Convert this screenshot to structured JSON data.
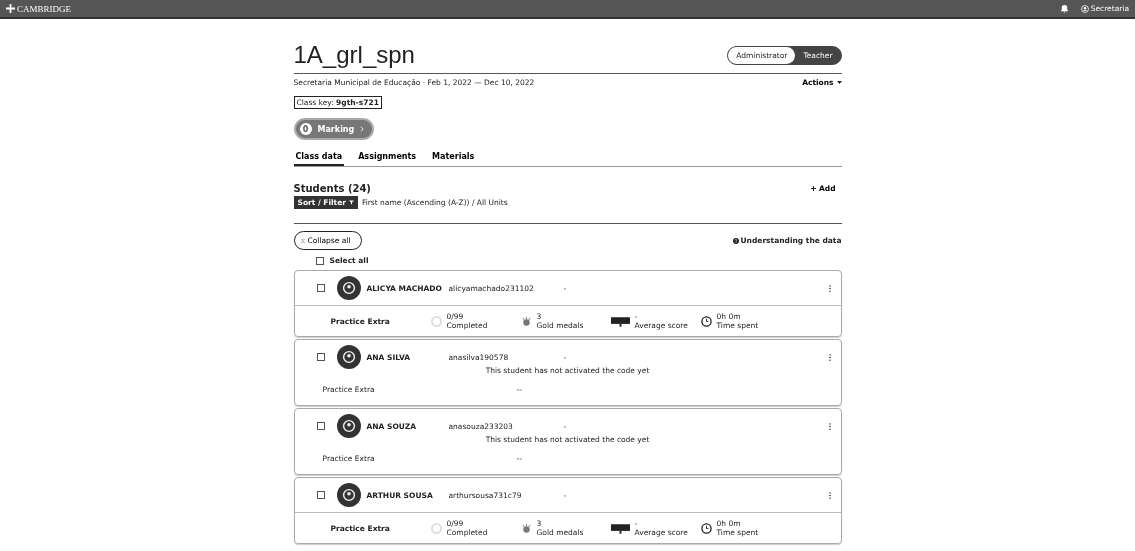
{
  "top_bar": {
    "logo": "CAMBRIDGE",
    "user": "Secretaria"
  },
  "class": {
    "title": "1A_grl_spn",
    "meta": "Secretaria Municipal de Educação · Feb 1, 2022 — Dec 10, 2022",
    "class_key_label": "Class key:",
    "class_key": "9gth-s721",
    "actions": "Actions"
  },
  "role_toggle": [
    {
      "label": "Administrator",
      "selected": true
    },
    {
      "label": "Teacher",
      "selected": false
    }
  ],
  "marking": {
    "count": "0",
    "label": "Marking"
  },
  "tabs": [
    {
      "label": "Class data",
      "selected": true
    },
    {
      "label": "Assignments",
      "selected": false
    },
    {
      "label": "Materials",
      "selected": false
    }
  ],
  "students_heading": "Students (24)",
  "add": "Add",
  "sort_filter": {
    "label": "Sort / Filter",
    "summary": "First name (Ascending (A-Z)) / All Units"
  },
  "collapse_all": "Collapse all",
  "understanding": "Understanding the data",
  "select_all": {
    "label": "Select all",
    "checked": false
  },
  "students": [
    {
      "name": "ALICYA MACHADO",
      "username": "alicyamachado231102",
      "extra": "-",
      "checked": false,
      "kind": "active",
      "course": "Practice Extra",
      "completed": "0/99",
      "completed_label": "Completed",
      "medals": "3",
      "medals_label": "Gold medals",
      "score": "-",
      "score_label": "Average score",
      "time": "0h 0m",
      "time_label": "Time spent"
    },
    {
      "name": "ANA SILVA",
      "username": "anasilva190578",
      "extra": "-",
      "checked": false,
      "kind": "inactive",
      "message": "This student has not activated the code yet",
      "course": "Practice Extra",
      "dash": "--"
    },
    {
      "name": "ANA SOUZA",
      "username": "anasouza233203",
      "extra": "-",
      "checked": false,
      "kind": "inactive",
      "message": "This student has not activated the code yet",
      "course": "Practice Extra",
      "dash": "--"
    },
    {
      "name": "ARTHUR SOUSA",
      "username": "arthursousa731c79",
      "extra": "-",
      "checked": false,
      "kind": "active",
      "course": "Practice Extra",
      "completed": "0/99",
      "completed_label": "Completed",
      "medals": "3",
      "medals_label": "Gold medals",
      "score": "-",
      "score_label": "Average score",
      "time": "0h 0m",
      "time_label": "Time spent"
    }
  ]
}
